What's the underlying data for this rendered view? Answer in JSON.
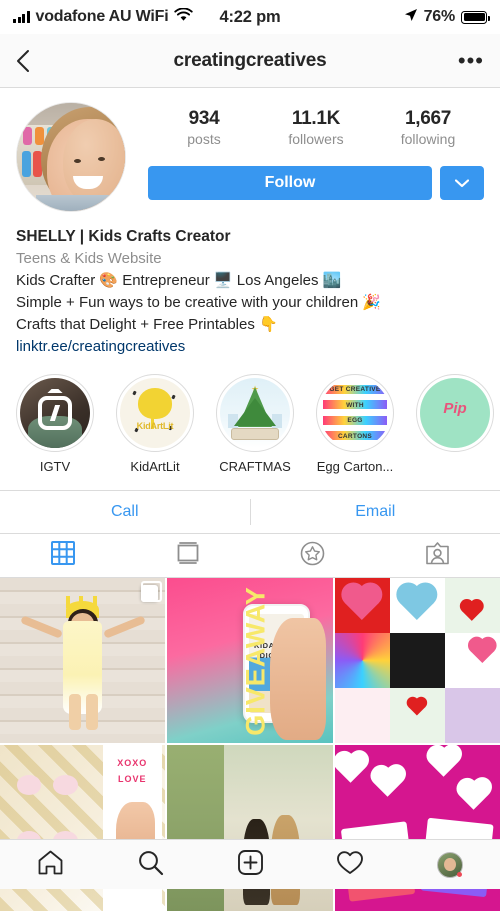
{
  "statusbar": {
    "carrier": "vodafone AU WiFi",
    "time": "4:22 pm",
    "battery_pct": "76%",
    "signal_icon": "signal-bars-icon",
    "wifi_icon": "wifi-icon",
    "location_icon": "location-arrow-icon",
    "battery_icon": "battery-icon"
  },
  "navbar": {
    "back_icon": "chevron-left-icon",
    "title": "creatingcreatives",
    "more_icon": "more-options-icon",
    "more_label": "•••"
  },
  "profile": {
    "avatar_alt": "profile-photo",
    "stats": [
      {
        "num": "934",
        "label": "posts"
      },
      {
        "num": "11.1K",
        "label": "followers"
      },
      {
        "num": "1,667",
        "label": "following"
      }
    ],
    "follow_label": "Follow",
    "caret_icon": "chevron-down-icon",
    "accent_color": "#3897f0"
  },
  "bio": {
    "name": "SHELLY | Kids Crafts Creator",
    "category": "Teens & Kids Website",
    "line1": "Kids Crafter 🎨 Entrepreneur 🖥️ Los Angeles 🏙️",
    "line2": "Simple + Fun ways to be creative with your children 🎉",
    "line3": "Crafts that Delight + Free Printables 👇",
    "link": "linktr.ee/creatingcreatives"
  },
  "highlights": [
    {
      "label": "IGTV",
      "kind": "igtv"
    },
    {
      "label": "KidArtLit",
      "kind": "kidartlit",
      "text": "KidArtLit"
    },
    {
      "label": "CRAFTMAS",
      "kind": "craftmas"
    },
    {
      "label": "Egg Carton...",
      "kind": "eggcarton",
      "lines": [
        "GET CREATIVE",
        "WITH",
        "EGG",
        "CARTONS"
      ]
    },
    {
      "label": "",
      "kind": "pip",
      "text": "Pip"
    }
  ],
  "contact": {
    "call_label": "Call",
    "email_label": "Email"
  },
  "tabs": [
    {
      "name": "grid-tab",
      "icon": "grid-icon",
      "active": true
    },
    {
      "name": "list-tab",
      "icon": "list-icon",
      "active": false
    },
    {
      "name": "saved-tab",
      "icon": "star-circle-icon",
      "active": false
    },
    {
      "name": "tagged-tab",
      "icon": "tagged-person-icon",
      "active": false
    }
  ],
  "posts": [
    {
      "name": "post-girl-sun-crown",
      "kind": "p1",
      "multi": true
    },
    {
      "name": "post-giveaway",
      "kind": "p2",
      "text": "GIVEAWAY",
      "phone_text": "KIDARTLIT\nDIGITAL",
      "multi": false
    },
    {
      "name": "post-valentine-collage",
      "kind": "p3",
      "multi": false
    },
    {
      "name": "post-egg-carton-xoxo",
      "kind": "p4",
      "text": "XOXO LOVE",
      "multi": false
    },
    {
      "name": "post-couple-outdoors",
      "kind": "p5",
      "multi": false
    },
    {
      "name": "post-valentine-cards",
      "kind": "p6",
      "multi": false
    }
  ],
  "bottomnav": [
    {
      "name": "home-tab",
      "icon": "home-icon"
    },
    {
      "name": "search-tab",
      "icon": "search-icon"
    },
    {
      "name": "add-post-tab",
      "icon": "plus-square-icon"
    },
    {
      "name": "activity-tab",
      "icon": "heart-icon"
    },
    {
      "name": "profile-tab",
      "icon": "avatar-icon",
      "badge": true
    }
  ]
}
